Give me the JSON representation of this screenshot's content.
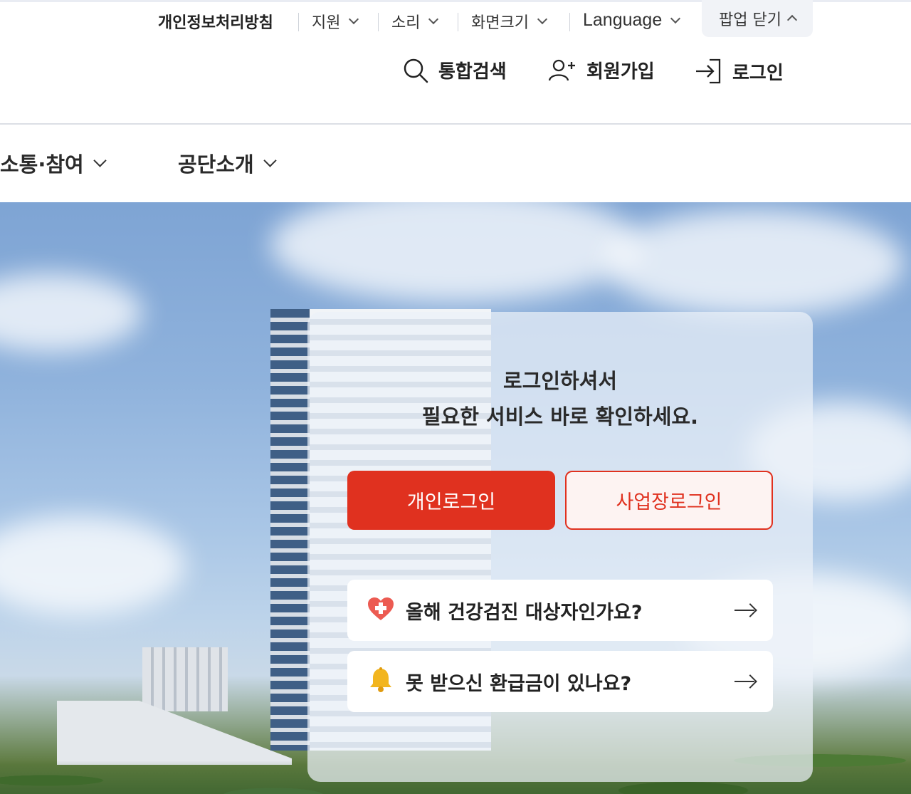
{
  "util_bar": {
    "privacy": "개인정보처리방침",
    "support": "지원",
    "sound": "소리",
    "screen_size": "화면크기",
    "language": "Language",
    "popup_close": "팝업 닫기"
  },
  "header": {
    "search": "통합검색",
    "signup": "회원가입",
    "login": "로그인"
  },
  "gnb": {
    "items": [
      {
        "label": "소통·참여"
      },
      {
        "label": "공단소개"
      }
    ]
  },
  "login_card": {
    "message_line1": "로그인하셔서",
    "message_line2": "필요한 서비스 바로 확인하세요.",
    "personal_login": "개인로그인",
    "business_login": "사업장로그인",
    "quick_links": [
      {
        "icon": "heart-cross-icon",
        "label": "올해 건강검진 대상자인가요?"
      },
      {
        "icon": "bell-icon",
        "label": "못 받으신 환급금이 있나요?"
      }
    ]
  },
  "colors": {
    "accent": "#e0311f",
    "accent_light": "#fdf3f2"
  }
}
